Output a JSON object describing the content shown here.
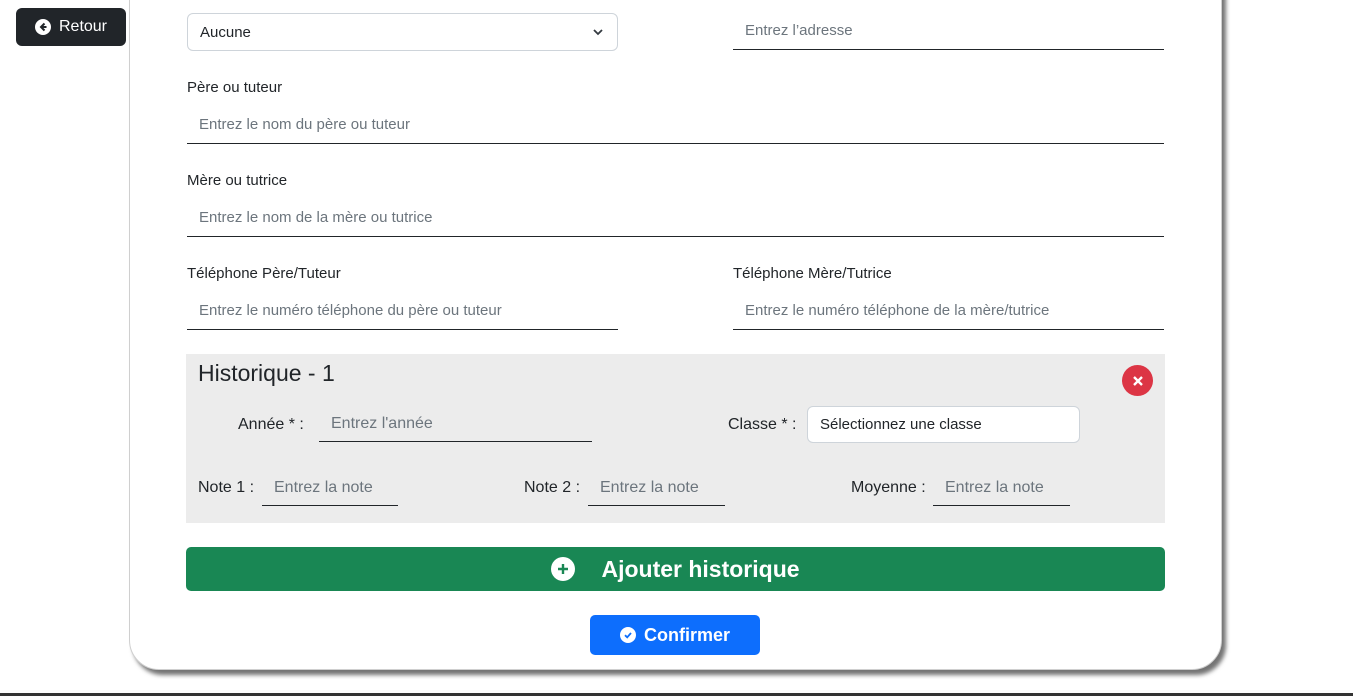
{
  "back_button": {
    "label": "Retour",
    "icon": "arrow-left-circle-icon"
  },
  "form": {
    "top_select": {
      "value": "Aucune"
    },
    "address": {
      "placeholder": "Entrez l’adresse"
    },
    "father": {
      "label": "Père ou tuteur",
      "placeholder": "Entrez le nom du père ou tuteur"
    },
    "mother": {
      "label": "Mère ou tutrice",
      "placeholder": "Entrez le nom de la mère ou tutrice"
    },
    "father_phone": {
      "label": "Téléphone Père/Tuteur",
      "placeholder": "Entrez le numéro téléphone du père ou tuteur"
    },
    "mother_phone": {
      "label": "Téléphone Mère/Tutrice",
      "placeholder": "Entrez le numéro téléphone de la mère/tutrice"
    }
  },
  "history": {
    "title": "Historique - 1",
    "year": {
      "label": "Année * :",
      "placeholder": "Entrez l'année"
    },
    "class": {
      "label": "Classe * :",
      "value": "Sélectionnez une classe"
    },
    "note1": {
      "label": "Note 1 :",
      "placeholder": "Entrez la note"
    },
    "note2": {
      "label": "Note 2 :",
      "placeholder": "Entrez la note"
    },
    "average": {
      "label": "Moyenne :",
      "placeholder": "Entrez la note"
    }
  },
  "add_history_button": {
    "label": "Ajouter historique"
  },
  "confirm_button": {
    "label": "Confirmer"
  },
  "colors": {
    "success": "#198754",
    "primary": "#0d6efd",
    "danger": "#dc3545",
    "dark": "#212529"
  }
}
